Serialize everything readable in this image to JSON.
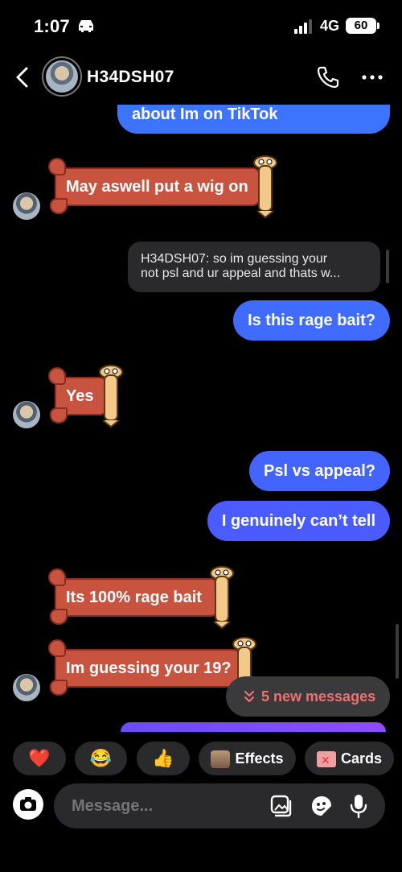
{
  "status_bar": {
    "time": "1:07",
    "network": "4G",
    "battery": "60"
  },
  "header": {
    "contact_name": "H34DSH07"
  },
  "messages": {
    "top_partial": "about Im on TikTok",
    "sticker_1": "May aswell put a wig on",
    "reply_card": {
      "line1": "H34DSH07: so im guessing your",
      "line2": "not psl and ur appeal and thats w..."
    },
    "out_1": "Is this rage bait?",
    "sticker_2": "Yes",
    "out_2": "Psl vs appeal?",
    "out_3": "I genuinely can’t tell",
    "sticker_3": "Its 100% rage bait",
    "sticker_4": "Im guessing your 19?"
  },
  "new_messages_pill": "5 new messages",
  "reactions": {
    "heart": "❤️",
    "laugh": "😂",
    "thumb": "👍",
    "effects": "Effects",
    "cards": "Cards"
  },
  "composer": {
    "placeholder": "Message..."
  },
  "colors": {
    "outgoing": "#3f6bff",
    "sticker": "#c8533f",
    "pill_text": "#f07070"
  }
}
